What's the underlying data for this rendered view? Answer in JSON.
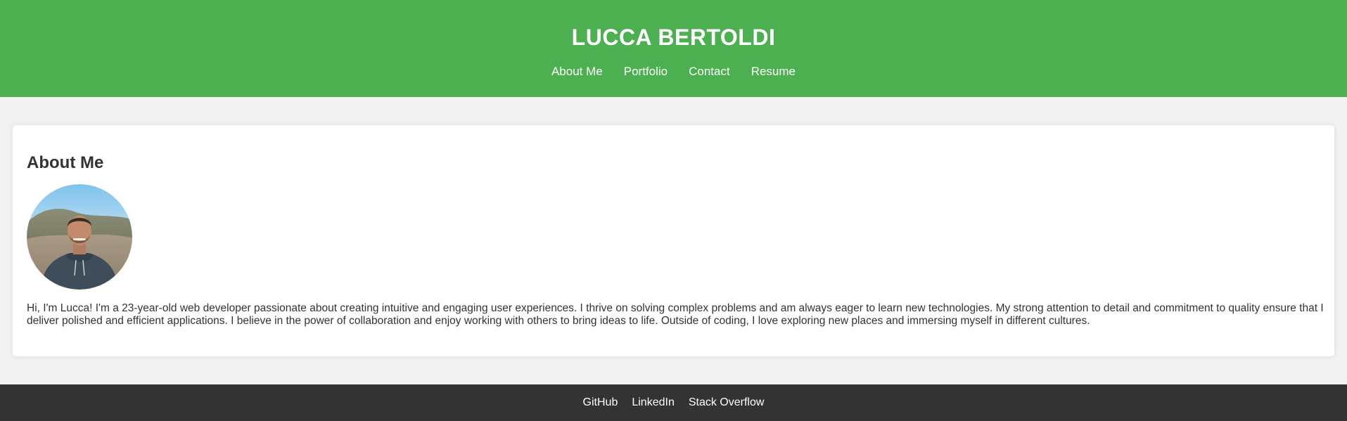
{
  "header": {
    "title": "LUCCA BERTOLDI",
    "nav": [
      "About Me",
      "Portfolio",
      "Contact",
      "Resume"
    ]
  },
  "about": {
    "heading": "About Me",
    "photo_alt": "profile-photo",
    "bio": "Hi, I'm Lucca! I'm a 23-year-old web developer passionate about creating intuitive and engaging user experiences. I thrive on solving complex problems and am always eager to learn new technologies. My strong attention to detail and commitment to quality ensure that I deliver polished and efficient applications. I believe in the power of collaboration and enjoy working with others to bring ideas to life. Outside of coding, I love exploring new places and immersing myself in different cultures."
  },
  "footer": {
    "links": [
      "GitHub",
      "LinkedIn",
      "Stack Overflow"
    ]
  },
  "colors": {
    "header_bg": "#4caf50",
    "footer_bg": "#333333",
    "page_bg": "#f2f2f2"
  }
}
